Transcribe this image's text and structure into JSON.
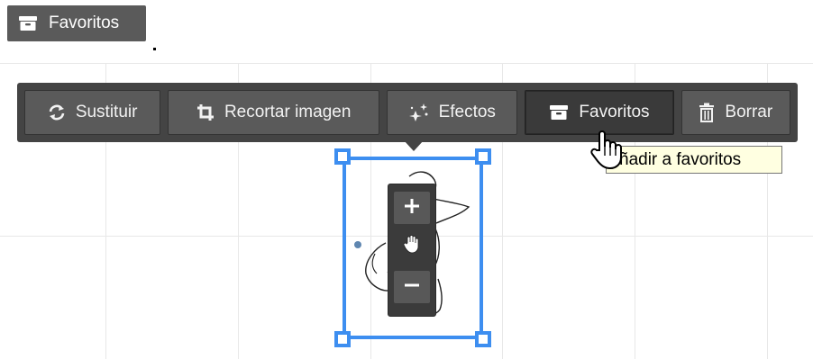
{
  "top_chip": {
    "label": "Favoritos",
    "icon": "archive-icon"
  },
  "toolbar": {
    "buttons": [
      {
        "label": "Sustituir",
        "icon": "replace-icon"
      },
      {
        "label": "Recortar imagen",
        "icon": "crop-icon"
      },
      {
        "label": "Efectos",
        "icon": "sparkle-icon"
      },
      {
        "label": "Favoritos",
        "icon": "archive-icon",
        "active": true
      },
      {
        "label": "Borrar",
        "icon": "trash-icon"
      }
    ]
  },
  "zoom": {
    "zoom_in_symbol": "+",
    "pan_icon": "hand-icon",
    "zoom_out_symbol": "−"
  },
  "tooltip": {
    "text": "ñadir a favoritos"
  },
  "colors": {
    "toolbar_bg": "#444444",
    "button_bg": "#5a5a5a",
    "selection": "#3d8ef0",
    "tooltip_bg": "#ffffe1"
  }
}
